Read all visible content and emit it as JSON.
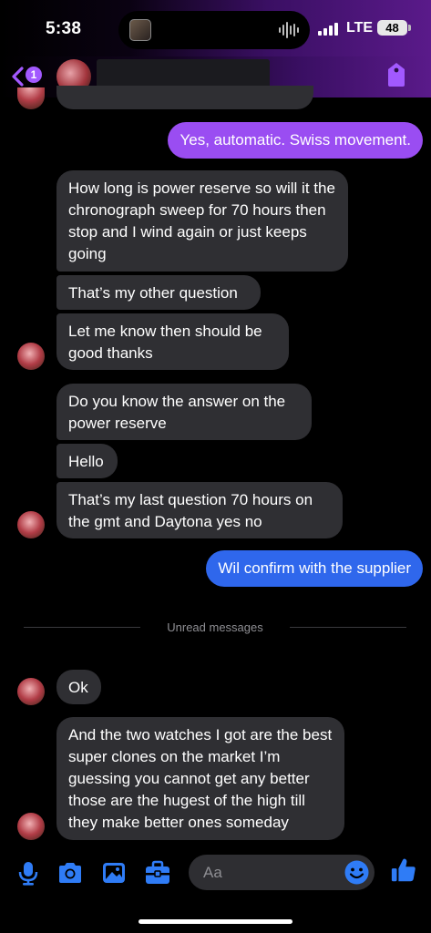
{
  "status_bar": {
    "time": "5:38",
    "network": "LTE",
    "battery": "48"
  },
  "header": {
    "unread_count": "1"
  },
  "messages": [
    {
      "direction": "outgoing",
      "text": "Yes, automatic. Swiss movement.",
      "color": "#9a4df2"
    },
    {
      "direction": "incoming",
      "text": "How long is power reserve so will it the chronograph sweep for 70 hours then stop and I wind again or just keeps going"
    },
    {
      "direction": "incoming",
      "text": "That’s my other question"
    },
    {
      "direction": "incoming",
      "text": "Let me know then should be good thanks"
    },
    {
      "direction": "incoming",
      "text": "Do you know the answer on the power reserve"
    },
    {
      "direction": "incoming",
      "text": "Hello"
    },
    {
      "direction": "incoming",
      "text": "That’s my last question 70 hours on the gmt and Daytona yes no"
    },
    {
      "direction": "outgoing",
      "text": "Wil confirm with the supplier",
      "color": "#2f67ec"
    },
    {
      "direction": "incoming",
      "text": "Ok"
    },
    {
      "direction": "incoming",
      "text": "And the two watches I got are the best super clones on the market I’m guessing you cannot get any better those are the hugest of the high till they make better ones someday"
    }
  ],
  "divider": {
    "label": "Unread messages"
  },
  "composer": {
    "placeholder": "Aa"
  },
  "icons": [
    "back-icon",
    "tag-icon",
    "microphone-icon",
    "camera-icon",
    "gallery-icon",
    "toolbox-icon",
    "emoji-icon",
    "thumbs-up-icon"
  ],
  "colors": {
    "accent_blue": "#2f7cf6",
    "outgoing_purple": "#9a4df2",
    "outgoing_blue": "#2f67ec",
    "incoming_bubble": "#2f2f33"
  }
}
